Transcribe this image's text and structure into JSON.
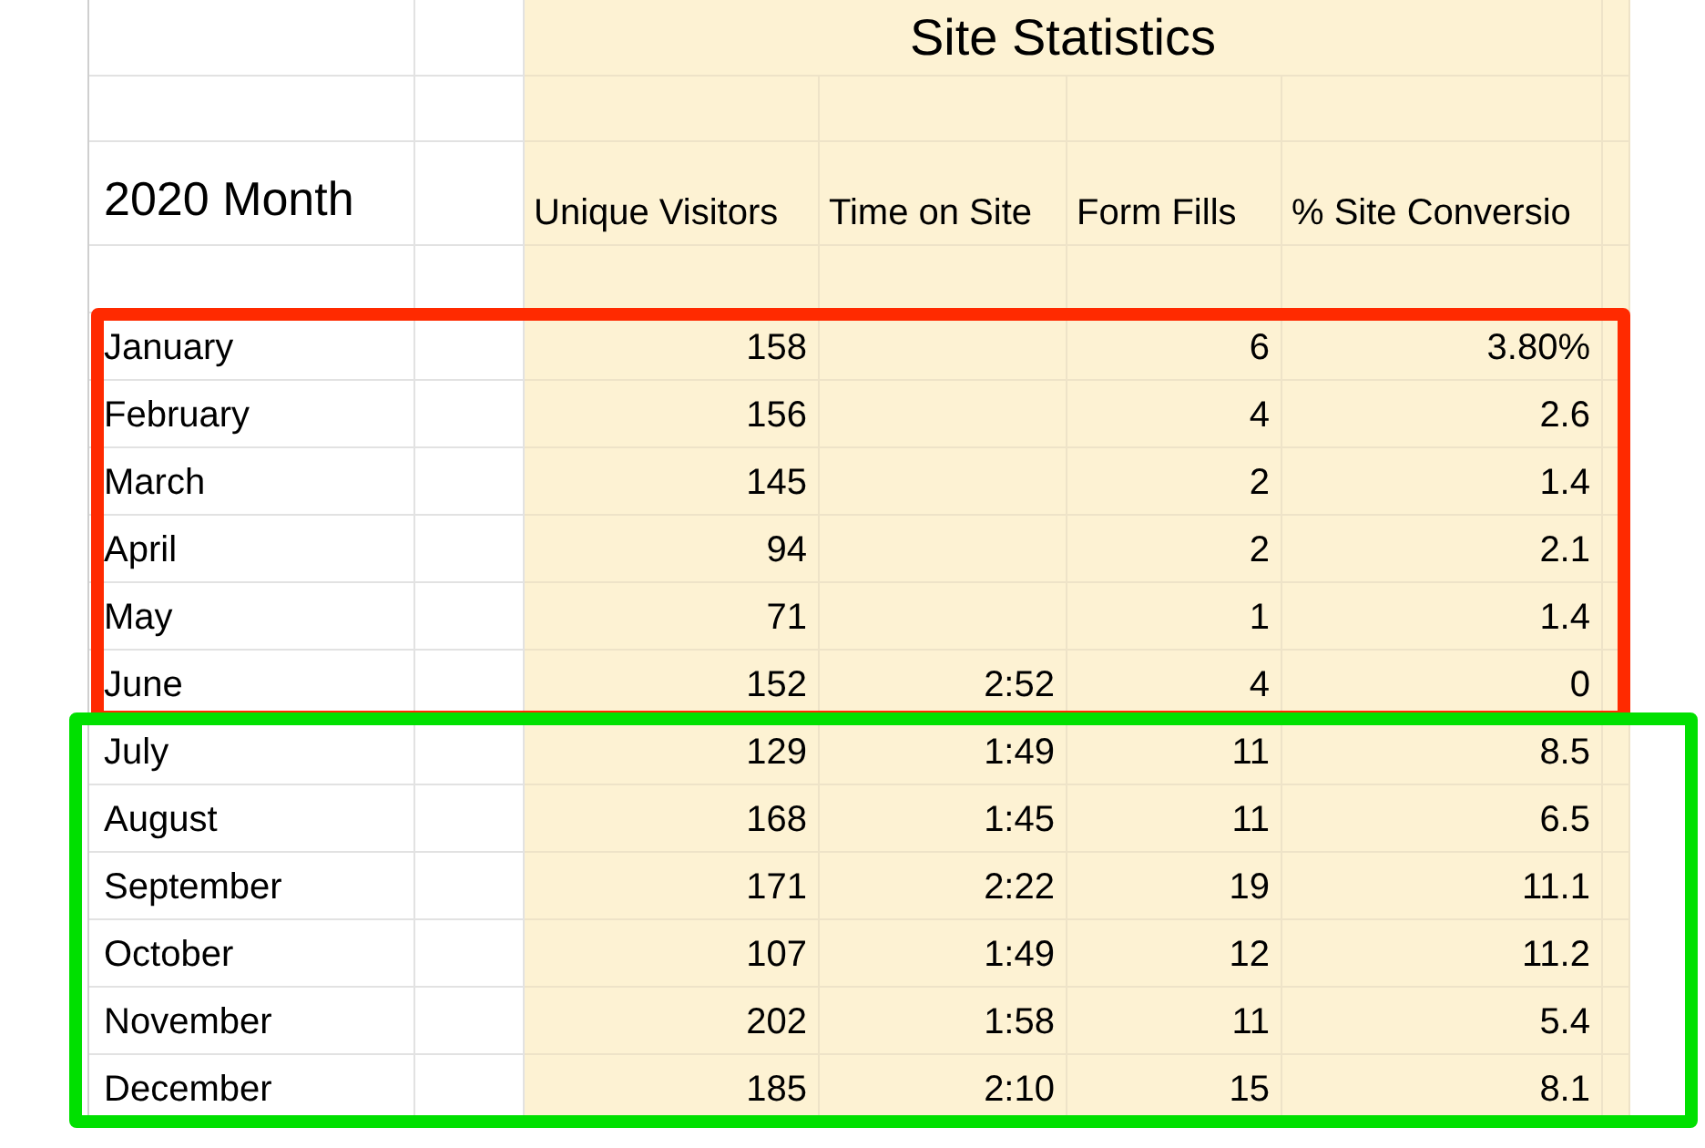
{
  "title": "Site Statistics",
  "month_header": "2020 Month",
  "columns": [
    "Unique Visitors",
    "Time on Site",
    "Form Fills",
    "% Site Conversio"
  ],
  "groups": [
    {
      "color": "#ff2a00",
      "rows": [
        {
          "month": "January",
          "visitors": "158",
          "fills": "6",
          "conversion": "3.80%"
        },
        {
          "month": "February",
          "visitors": "156",
          "fills": "4",
          "conversion": "2.6"
        },
        {
          "month": "March",
          "visitors": "145",
          "fills": "2",
          "conversion": "1.4"
        },
        {
          "month": "April",
          "visitors": "94",
          "fills": "2",
          "conversion": "2.1"
        },
        {
          "month": "May",
          "visitors": "71",
          "fills": "1",
          "conversion": "1.4"
        },
        {
          "month": "June",
          "visitors": "152",
          "time": "2:52",
          "fills": "4",
          "conversion": "0"
        }
      ]
    },
    {
      "color": "#00e000",
      "rows": [
        {
          "month": "July",
          "visitors": "129",
          "time": "1:49",
          "fills": "11",
          "conversion": "8.5"
        },
        {
          "month": "August",
          "visitors": "168",
          "time": "1:45",
          "fills": "11",
          "conversion": "6.5"
        },
        {
          "month": "September",
          "visitors": "171",
          "time": "2:22",
          "fills": "19",
          "conversion": "11.1"
        },
        {
          "month": "October",
          "visitors": "107",
          "time": "1:49",
          "fills": "12",
          "conversion": "11.2"
        },
        {
          "month": "November",
          "visitors": "202",
          "time": "1:58",
          "fills": "11",
          "conversion": "5.4"
        },
        {
          "month": "December",
          "visitors": "185",
          "time": "2:10",
          "fills": "15",
          "conversion": "8.1"
        }
      ]
    }
  ]
}
